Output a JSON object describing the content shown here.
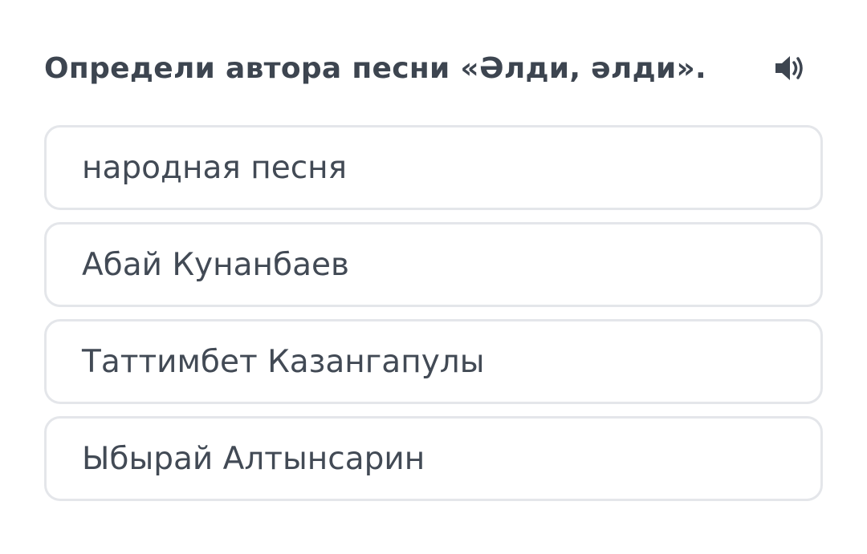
{
  "question": {
    "text": "Определи автора песни «Әлди, әлди».",
    "audio_icon": "speaker-volume-icon"
  },
  "options": [
    {
      "label": "народная песня"
    },
    {
      "label": "Абай Кунанбаев"
    },
    {
      "label": "Таттимбет Казангапулы"
    },
    {
      "label": "Ыбырай Алтынсарин"
    }
  ],
  "colors": {
    "text": "#3d4550",
    "border": "#e4e6ea",
    "background": "#ffffff"
  }
}
